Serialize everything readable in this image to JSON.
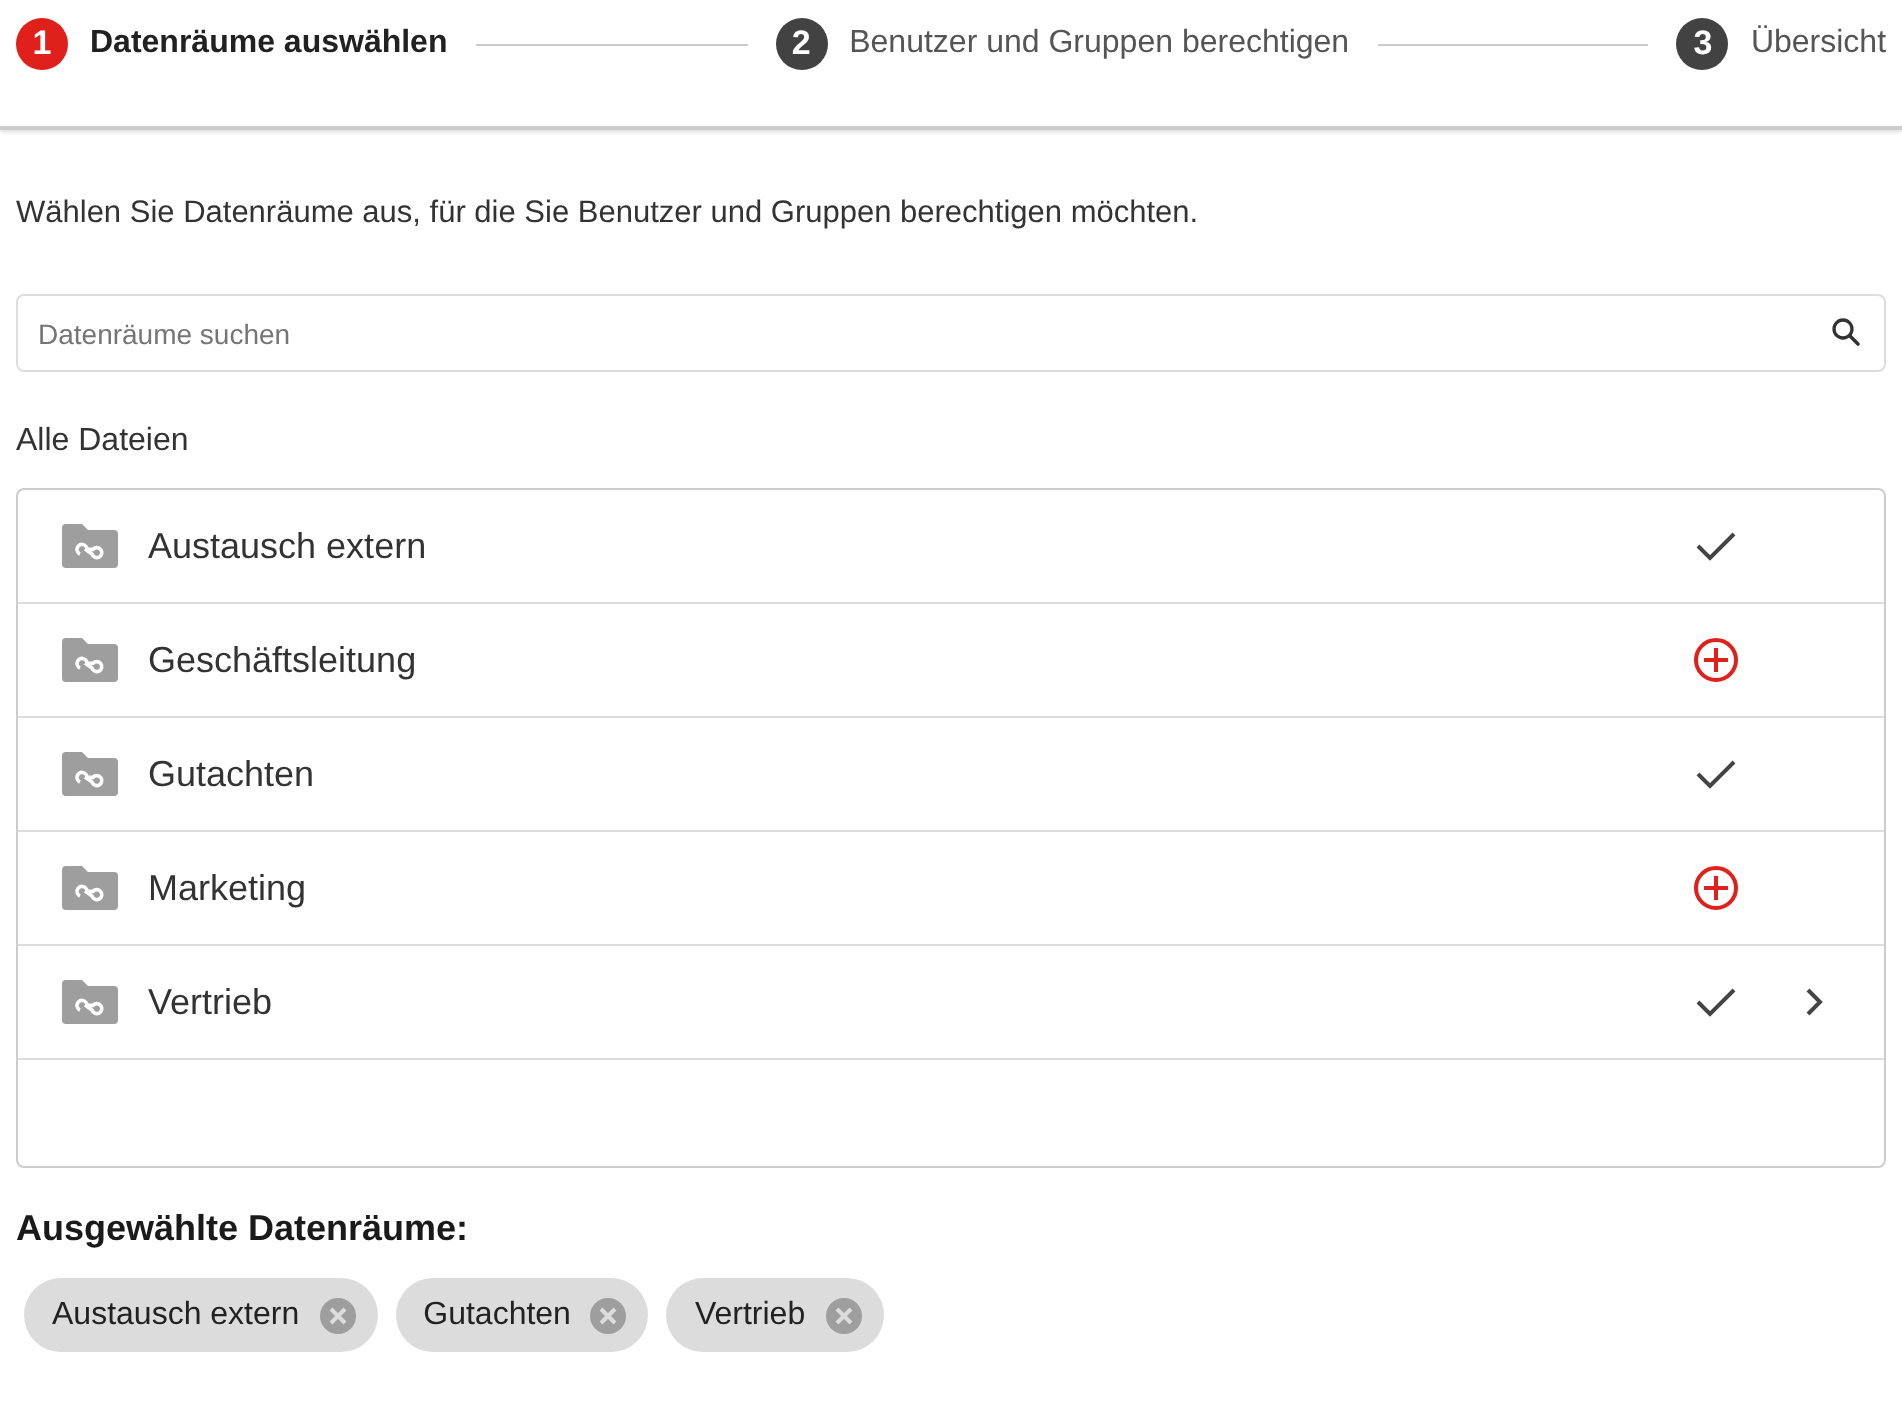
{
  "steps": [
    {
      "number": "1",
      "label": "Datenräume auswählen",
      "selected": true
    },
    {
      "number": "2",
      "label": "Benutzer und Gruppen berechtigen",
      "selected": false
    },
    {
      "number": "3",
      "label": "Übersicht",
      "selected": false
    }
  ],
  "intro": "Wählen Sie Datenräume aus, für die Sie Benutzer und Gruppen berechtigen möchten.",
  "search": {
    "placeholder": "Datenräume suchen"
  },
  "list_title": "Alle Dateien",
  "rooms": [
    {
      "name": "Austausch extern",
      "selected": true,
      "expandable": false
    },
    {
      "name": "Geschäftsleitung",
      "selected": false,
      "expandable": false
    },
    {
      "name": "Gutachten",
      "selected": true,
      "expandable": false
    },
    {
      "name": "Marketing",
      "selected": false,
      "expandable": false
    },
    {
      "name": "Vertrieb",
      "selected": true,
      "expandable": true
    }
  ],
  "selected_title": "Ausgewählte Datenräume:",
  "chips": [
    "Austausch extern",
    "Gutachten",
    "Vertrieb"
  ]
}
